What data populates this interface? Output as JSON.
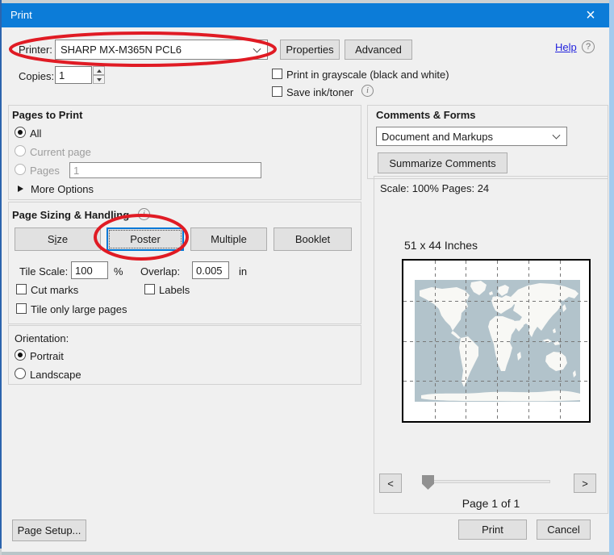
{
  "window": {
    "title": "Print",
    "close_glyph": "×"
  },
  "colors": {
    "title_bar": "#0c7cd8",
    "annotation_red": "#e01b24",
    "selected_button_border": "#0078d7",
    "map_ocean": "#b2c3cb",
    "map_land": "#f8f8f5",
    "help_link": "#2323dd"
  },
  "printer_row": {
    "label": "Printer:",
    "printer_name": "SHARP MX-M365N PCL6",
    "properties_label": "Properties",
    "advanced_label": "Advanced",
    "help_label": "Help",
    "help_glyph": "?"
  },
  "copies_row": {
    "label": "Copies:",
    "value": "1",
    "grayscale_label": "Print in grayscale (black and white)",
    "save_ink_label": "Save ink/toner",
    "info_glyph": "i"
  },
  "pages_to_print": {
    "title": "Pages to Print",
    "all_label": "All",
    "current_label": "Current page",
    "pages_label": "Pages",
    "pages_value": "1",
    "more_options_label": "More Options"
  },
  "page_sizing": {
    "title": "Page Sizing & Handling",
    "info_glyph": "i",
    "size_pre": "S",
    "size_mnemonic": "i",
    "size_post": "ze",
    "poster_label": "Poster",
    "multiple_label": "Multiple",
    "booklet_label": "Booklet",
    "tile_scale_label": "Tile Scale:",
    "tile_scale_value": "100",
    "tile_scale_unit": "%",
    "overlap_label": "Overlap:",
    "overlap_value": "0.005",
    "overlap_unit": "in",
    "cut_marks_label": "Cut marks",
    "labels_label": "Labels",
    "tile_only_label": "Tile only large pages"
  },
  "orientation": {
    "title": "Orientation:",
    "portrait_label": "Portrait",
    "landscape_label": "Landscape"
  },
  "comments_forms": {
    "title": "Comments & Forms",
    "selected_option": "Document and Markups",
    "summarize_label": "Summarize Comments"
  },
  "preview": {
    "scale_text": "Scale: 100% Pages: 24",
    "dimensions_text": "51 x 44 Inches",
    "page_text": "Page 1 of 1",
    "prev_glyph": "<",
    "next_glyph": ">",
    "tile_columns": 6,
    "tile_rows": 4
  },
  "footer": {
    "page_setup_label": "Page Setup...",
    "print_label": "Print",
    "cancel_label": "Cancel"
  }
}
